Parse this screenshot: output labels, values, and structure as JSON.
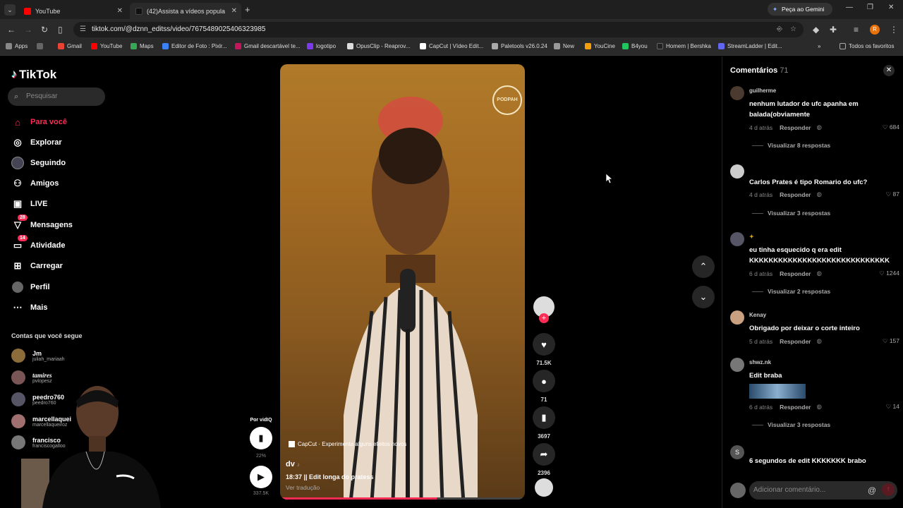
{
  "browser": {
    "tabs": [
      {
        "title": "YouTube",
        "active": false
      },
      {
        "title": "(42)Assista a vídeos popula",
        "active": true
      }
    ],
    "gemini_label": "Peça ao Gemini",
    "url": "tiktok.com/@dznn_editss/video/7675489025406323985",
    "bookmarks": [
      "Apps",
      "Gmail",
      "YouTube",
      "Maps",
      "Editor de Foto : Pixlr...",
      "Gmail descartável te...",
      "logotipo",
      "OpusClip - Reaprov...",
      "CapCut | Vídeo Edit...",
      "Paletools v26.0.24",
      "New",
      "YouCine",
      "B4you",
      "Homem | Bershka",
      "StreamLadder | Edit...",
      "Todos os favoritos"
    ]
  },
  "sidebar": {
    "logo": "TikTok",
    "search_placeholder": "Pesquisar",
    "nav": [
      {
        "label": "Para você",
        "icon": "home-icon",
        "active": true
      },
      {
        "label": "Explorar",
        "icon": "compass-icon"
      },
      {
        "label": "Seguindo",
        "icon": "following-icon"
      },
      {
        "label": "Amigos",
        "icon": "friends-icon"
      },
      {
        "label": "LIVE",
        "icon": "live-icon"
      },
      {
        "label": "Mensagens",
        "icon": "messages-icon",
        "badge": "28"
      },
      {
        "label": "Atividade",
        "icon": "activity-icon",
        "badge": "14"
      },
      {
        "label": "Carregar",
        "icon": "upload-icon"
      },
      {
        "label": "Perfil",
        "icon": "profile-icon"
      },
      {
        "label": "Mais",
        "icon": "more-icon"
      }
    ],
    "following_title": "Contas que você segue",
    "accounts": [
      {
        "name": "Jm",
        "handle": "juliah_mariaah"
      },
      {
        "name": "tamires",
        "handle": "pvlopesz"
      },
      {
        "name": "peedro760",
        "handle": "peedro760"
      },
      {
        "name": "marcellaquei",
        "handle": "marcellaqueiroz"
      },
      {
        "name": "francisco",
        "handle": "franciscogalloo"
      }
    ]
  },
  "video": {
    "capcut_label": "CapCut · Experimenta alguns efeitos novos",
    "author": "dv",
    "description": "18:37 || Edit longa do pratess",
    "translate": "Ver tradução",
    "watermark": "PODPAH",
    "progress": 0.64
  },
  "actions": {
    "likes": "71.5K",
    "comments": "71",
    "saves": "3697",
    "shares": "2396"
  },
  "vidiq": {
    "label": "Por vidIQ",
    "percent": "22%",
    "views": "337.5K"
  },
  "comments": {
    "title": "Comentários",
    "count": "71",
    "input_placeholder": "Adicionar comentário...",
    "items": [
      {
        "user": "guilherme",
        "text": "nenhum lutador de ufc apanha em balada(obviamente",
        "time": "4 d atrás",
        "reply": "Responder",
        "likes": "684",
        "replies": "Visualizar 8 respostas"
      },
      {
        "user": "",
        "text": "Carlos Prates é tipo Romario do ufc?",
        "time": "4 d atrás",
        "reply": "Responder",
        "likes": "87",
        "replies": "Visualizar 3 respostas"
      },
      {
        "user": "",
        "text": "eu tinha esquecido q era edit KKKKKKKKKKKKKKKKKKKKKKKKKKKKK",
        "time": "6 d atrás",
        "reply": "Responder",
        "likes": "1244",
        "replies": "Visualizar 2 respostas"
      },
      {
        "user": "Kenay",
        "text": "Obrigado por deixar o corte inteiro",
        "time": "5 d atrás",
        "reply": "Responder",
        "likes": "157",
        "replies": ""
      },
      {
        "user": "shwz.nk",
        "text": "Edit braba",
        "time": "6 d atrás",
        "reply": "Responder",
        "likes": "14",
        "replies": "Visualizar 3 respostas"
      },
      {
        "user": "",
        "text": "6 segundos de edit KKKKKKK brabo",
        "time": "",
        "reply": "",
        "likes": "",
        "replies": ""
      }
    ]
  }
}
